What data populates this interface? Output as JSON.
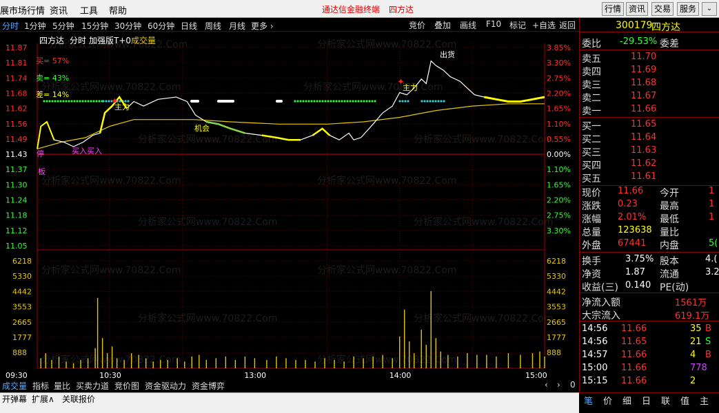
{
  "menubar": {
    "items": [
      "展市场行情",
      "资讯",
      "工具",
      "帮助"
    ],
    "promo": [
      "通达信金融终端",
      "四方达"
    ],
    "right_buttons": [
      "行情",
      "资讯",
      "交易",
      "服务"
    ]
  },
  "period_tabs": [
    "分时",
    "1分钟",
    "5分钟",
    "15分钟",
    "30分钟",
    "60分钟",
    "日线",
    "周线",
    "月线",
    "更多 ›"
  ],
  "tool_buttons": [
    "竞价",
    "叠加",
    "画线",
    "F10",
    "标记",
    "+自选",
    "返回"
  ],
  "chart": {
    "header": {
      "name": "四方达",
      "mode": "分时",
      "indicator": "加强版T+0",
      "series_label": "成交量"
    },
    "buy_ratio": "买= 57%",
    "sell_ratio": "卖= 43%",
    "diff_ratio": "差= 14%",
    "watermark": "分析家公式网www.70822.Com",
    "signals": {
      "stop": "停",
      "board": "板",
      "buybuy": "买入买入",
      "main_force": "主力",
      "main_force2": "主力",
      "chance": "机会",
      "ship": "出货"
    }
  },
  "chart_data": {
    "type": "line",
    "x_ticks": [
      "09:30",
      "10:30",
      "13:00",
      "14:00",
      "15:00"
    ],
    "price_ticks": [
      "11.87",
      "11.81",
      "11.74",
      "11.68",
      "11.62",
      "11.56",
      "11.49",
      "11.43",
      "11.37",
      "11.30",
      "11.24",
      "11.18",
      "11.12",
      "11.05"
    ],
    "pct_ticks": [
      "3.85%",
      "3.30%",
      "2.75%",
      "2.20%",
      "1.65%",
      "1.10%",
      "0.55%",
      "0.00%",
      "1.10%",
      "1.65%",
      "2.20%",
      "2.75%",
      "3.30%"
    ],
    "pct_visible_order": [
      "3.85%",
      "3.30%",
      "2.75%",
      "2.20%",
      "1.65%",
      "1.10%",
      "0.55%",
      "0.00%",
      "1.10%",
      "1.65%",
      "2.20%",
      "2.75%",
      "3.30%"
    ],
    "volume_ticks": [
      "6218",
      "5330",
      "4442",
      "3553",
      "2665",
      "1777",
      "888"
    ],
    "prev_close": 11.43,
    "y_range": [
      11.0,
      11.88
    ],
    "volume_range": [
      0,
      6900
    ],
    "price_series": [
      [
        0,
        11.43
      ],
      [
        3,
        11.53
      ],
      [
        8,
        11.55
      ],
      [
        14,
        11.47
      ],
      [
        22,
        11.46
      ],
      [
        30,
        11.44
      ],
      [
        38,
        11.46
      ],
      [
        46,
        11.49
      ],
      [
        52,
        11.5
      ],
      [
        56,
        11.59
      ],
      [
        62,
        11.62
      ],
      [
        68,
        11.66
      ],
      [
        74,
        11.61
      ],
      [
        80,
        11.64
      ],
      [
        88,
        11.62
      ],
      [
        100,
        11.65
      ],
      [
        115,
        11.66
      ],
      [
        124,
        11.64
      ],
      [
        131,
        11.58
      ],
      [
        140,
        11.55
      ],
      [
        150,
        11.54
      ],
      [
        160,
        11.52
      ],
      [
        172,
        11.5
      ],
      [
        186,
        11.49
      ],
      [
        198,
        11.48
      ],
      [
        208,
        11.47
      ],
      [
        218,
        11.47
      ],
      [
        228,
        11.49
      ],
      [
        236,
        11.52
      ],
      [
        242,
        11.49
      ],
      [
        250,
        11.47
      ],
      [
        258,
        11.5
      ],
      [
        262,
        11.47
      ],
      [
        268,
        11.48
      ],
      [
        278,
        11.54
      ],
      [
        286,
        11.59
      ],
      [
        294,
        11.62
      ],
      [
        300,
        11.68
      ],
      [
        306,
        11.67
      ],
      [
        312,
        11.7
      ],
      [
        318,
        11.74
      ],
      [
        322,
        11.72
      ],
      [
        326,
        11.82
      ],
      [
        330,
        11.8
      ],
      [
        336,
        11.78
      ],
      [
        342,
        11.75
      ],
      [
        350,
        11.73
      ],
      [
        356,
        11.7
      ],
      [
        362,
        11.67
      ],
      [
        370,
        11.66
      ],
      [
        380,
        11.65
      ],
      [
        390,
        11.64
      ],
      [
        400,
        11.64
      ],
      [
        410,
        11.65
      ],
      [
        420,
        11.66
      ]
    ],
    "avg_series": [
      [
        0,
        11.43
      ],
      [
        20,
        11.46
      ],
      [
        40,
        11.48
      ],
      [
        60,
        11.53
      ],
      [
        80,
        11.56
      ],
      [
        100,
        11.56
      ],
      [
        130,
        11.56
      ],
      [
        160,
        11.55
      ],
      [
        200,
        11.54
      ],
      [
        240,
        11.54
      ],
      [
        270,
        11.55
      ],
      [
        300,
        11.57
      ],
      [
        330,
        11.6
      ],
      [
        360,
        11.62
      ],
      [
        390,
        11.63
      ],
      [
        420,
        11.63
      ]
    ],
    "volume_series": [
      [
        3,
        600
      ],
      [
        7,
        900
      ],
      [
        12,
        500
      ],
      [
        18,
        700
      ],
      [
        24,
        400
      ],
      [
        30,
        300
      ],
      [
        36,
        500
      ],
      [
        42,
        600
      ],
      [
        48,
        1200
      ],
      [
        50,
        4200
      ],
      [
        54,
        1800
      ],
      [
        58,
        900
      ],
      [
        62,
        1300
      ],
      [
        66,
        600
      ],
      [
        72,
        500
      ],
      [
        78,
        900
      ],
      [
        84,
        800
      ],
      [
        90,
        600
      ],
      [
        96,
        400
      ],
      [
        102,
        500
      ],
      [
        108,
        500
      ],
      [
        116,
        600
      ],
      [
        122,
        400
      ],
      [
        128,
        700
      ],
      [
        134,
        800
      ],
      [
        140,
        500
      ],
      [
        148,
        600
      ],
      [
        156,
        700
      ],
      [
        164,
        500
      ],
      [
        172,
        700
      ],
      [
        180,
        600
      ],
      [
        190,
        500
      ],
      [
        198,
        700
      ],
      [
        206,
        600
      ],
      [
        214,
        500
      ],
      [
        222,
        500
      ],
      [
        230,
        400
      ],
      [
        238,
        600
      ],
      [
        246,
        500
      ],
      [
        254,
        400
      ],
      [
        262,
        700
      ],
      [
        270,
        600
      ],
      [
        278,
        700
      ],
      [
        286,
        800
      ],
      [
        294,
        600
      ],
      [
        300,
        1900
      ],
      [
        304,
        3500
      ],
      [
        308,
        1600
      ],
      [
        312,
        900
      ],
      [
        318,
        2300
      ],
      [
        322,
        1400
      ],
      [
        326,
        4600
      ],
      [
        330,
        1800
      ],
      [
        334,
        1000
      ],
      [
        340,
        800
      ],
      [
        348,
        700
      ],
      [
        356,
        900
      ],
      [
        364,
        800
      ],
      [
        372,
        800
      ],
      [
        380,
        700
      ],
      [
        390,
        900
      ],
      [
        400,
        800
      ],
      [
        410,
        900
      ],
      [
        416,
        1000
      ],
      [
        420,
        700
      ]
    ]
  },
  "quote_panel": {
    "code": "300179",
    "name": "四方达",
    "weibi_label": "委比",
    "weibi_value": "-29.53%",
    "weicha_label": "委差",
    "sell_levels": [
      {
        "label": "卖五",
        "price": "11.70"
      },
      {
        "label": "卖四",
        "price": "11.69"
      },
      {
        "label": "卖三",
        "price": "11.68"
      },
      {
        "label": "卖二",
        "price": "11.67"
      },
      {
        "label": "卖一",
        "price": "11.66"
      }
    ],
    "buy_levels": [
      {
        "label": "买一",
        "price": "11.65"
      },
      {
        "label": "买二",
        "price": "11.64"
      },
      {
        "label": "买三",
        "price": "11.63"
      },
      {
        "label": "买四",
        "price": "11.62"
      },
      {
        "label": "买五",
        "price": "11.61"
      }
    ],
    "stats": [
      {
        "l1": "现价",
        "v1": "11.66",
        "l2": "今开",
        "v2": "1"
      },
      {
        "l1": "涨跌",
        "v1": "0.23",
        "l2": "最高",
        "v2": "1"
      },
      {
        "l1": "涨幅",
        "v1": "2.01%",
        "l2": "最低",
        "v2": "1"
      },
      {
        "l1": "总量",
        "v1": "123638",
        "l2": "量比",
        "v2": ""
      },
      {
        "l1": "外盘",
        "v1": "67441",
        "l2": "内盘",
        "v2": "5("
      }
    ],
    "stats2": [
      {
        "l1": "换手",
        "v1": "3.75%",
        "l2": "股本",
        "v2": "4.("
      },
      {
        "l1": "净资",
        "v1": "1.87",
        "l2": "流通",
        "v2": "3.2"
      },
      {
        "l1": "收益(三)",
        "v1": "0.140",
        "l2": "PE(动)",
        "v2": ""
      }
    ],
    "flows": [
      {
        "label": "净流入额",
        "value": "1561万"
      },
      {
        "label": "大宗流入",
        "value": "619.1万"
      }
    ],
    "ticks": [
      {
        "time": "14:56",
        "price": "11.66",
        "vol": "35",
        "side": "B"
      },
      {
        "time": "14:56",
        "price": "11.65",
        "vol": "21",
        "side": "S"
      },
      {
        "time": "14:57",
        "price": "11.66",
        "vol": "4",
        "side": "B"
      },
      {
        "time": "15:00",
        "price": "11.66",
        "vol": "778",
        "side": ""
      },
      {
        "time": "15:15",
        "price": "11.66",
        "vol": "2",
        "side": ""
      }
    ]
  },
  "bottom_tabs": [
    "成交量",
    "指标",
    "量比",
    "买卖力道",
    "竞价图",
    "资金驱动力",
    "资金博弈"
  ],
  "bottom_right": {
    "left": "‹",
    "right": "›",
    "zoom": "0"
  },
  "status_items": [
    "开弹幕",
    "扩展∧",
    "关联报价"
  ],
  "right_tabs": [
    "笔",
    "价",
    "细",
    "日",
    "联",
    "值",
    "主"
  ]
}
